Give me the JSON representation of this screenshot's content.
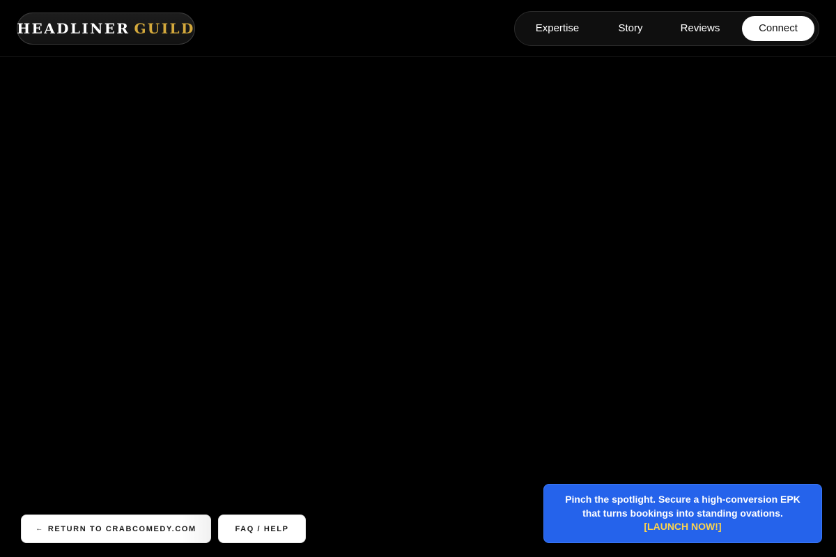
{
  "brand": {
    "name_part1": "HEADLINER",
    "name_part2": "GUILD",
    "accent_color": "#d4a93c"
  },
  "nav": {
    "items": [
      {
        "label": "Expertise"
      },
      {
        "label": "Story"
      },
      {
        "label": "Reviews"
      },
      {
        "label": "Connect",
        "active": true
      }
    ]
  },
  "footer_buttons": {
    "return_arrow": "←",
    "return_label": "RETURN TO CRABCOMEDY.COM",
    "faq_label": "FAQ / HELP"
  },
  "promo": {
    "line1": "Pinch the spotlight. Secure a high-conversion EPK",
    "line2": "that turns bookings into standing ovations.",
    "cta": "[LAUNCH NOW!]",
    "background_color": "#2563eb",
    "cta_color": "#fcd34d"
  },
  "colors": {
    "page_background": "#000000"
  }
}
